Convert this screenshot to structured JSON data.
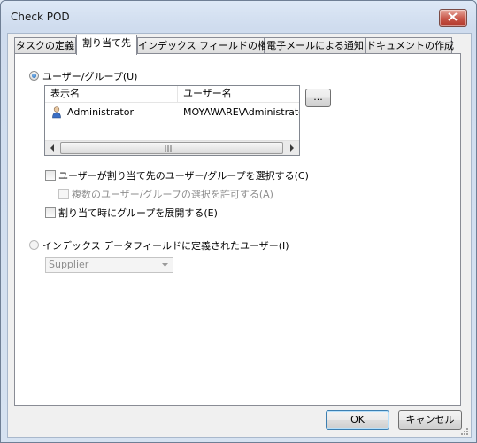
{
  "window": {
    "title": "Check POD"
  },
  "tabs": [
    {
      "label": "タスクの定義"
    },
    {
      "label": "割り当て先"
    },
    {
      "label": "インデックス フィールドの権限"
    },
    {
      "label": "電子メールによる通知"
    },
    {
      "label": "ドキュメントの作成"
    }
  ],
  "active_tab": 1,
  "assign": {
    "users_radio_label": "ユーザー/グループ(U)",
    "users_radio_checked": true,
    "list": {
      "columns": [
        "表示名",
        "ユーザー名"
      ],
      "rows": [
        {
          "display_name": "Administrator",
          "user_name": "MOYAWARE\\Administrator"
        }
      ]
    },
    "browse_button": "...",
    "select_at_assign_label": "ユーザーが割り当て先のユーザー/グループを選択する(C)",
    "select_at_assign_checked": false,
    "allow_multiple_label": "複数のユーザー/グループの選択を許可する(A)",
    "allow_multiple_checked": false,
    "expand_group_label": "割り当て時にグループを展開する(E)",
    "expand_group_checked": false,
    "index_field_radio_label": "インデックス データフィールドに定義されたユーザー(I)",
    "index_field_radio_checked": false,
    "index_field_value": "Supplier"
  },
  "buttons": {
    "ok": "OK",
    "cancel": "キャンセル"
  }
}
